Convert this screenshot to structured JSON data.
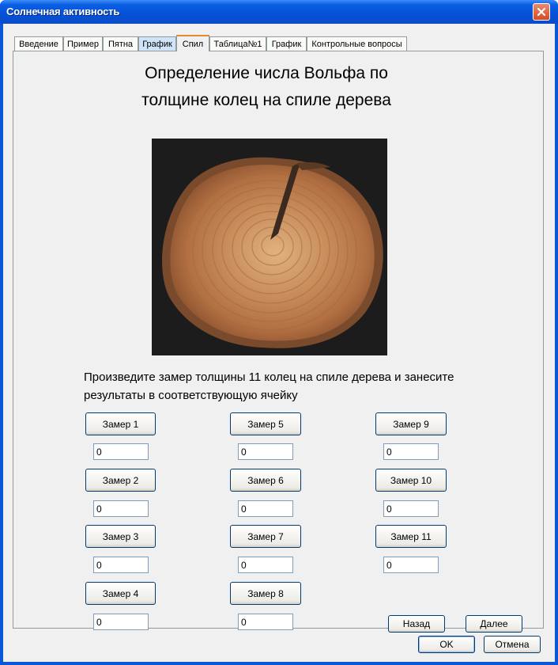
{
  "window": {
    "title": "Солнечная активность"
  },
  "tabs": [
    {
      "label": "Введение"
    },
    {
      "label": "Пример"
    },
    {
      "label": "Пятна"
    },
    {
      "label": "График"
    },
    {
      "label": "Спил"
    },
    {
      "label": "Таблица№1"
    },
    {
      "label": "График"
    },
    {
      "label": "Контрольные вопросы"
    }
  ],
  "active_tab": "Спил",
  "main": {
    "heading_line1": "Определение числа Вольфа по",
    "heading_line2": "толщине колец на спиле дерева",
    "instruction": "Произведите замер толщины 11 колец на спиле дерева и занесите результаты в соответствующую ячейку"
  },
  "measurements": [
    {
      "label": "Замер 1",
      "value": "0"
    },
    {
      "label": "Замер 2",
      "value": "0"
    },
    {
      "label": "Замер 3",
      "value": "0"
    },
    {
      "label": "Замер 4",
      "value": "0"
    },
    {
      "label": "Замер 5",
      "value": "0"
    },
    {
      "label": "Замер 6",
      "value": "0"
    },
    {
      "label": "Замер 7",
      "value": "0"
    },
    {
      "label": "Замер 8",
      "value": "0"
    },
    {
      "label": "Замер 9",
      "value": "0"
    },
    {
      "label": "Замер 10",
      "value": "0"
    },
    {
      "label": "Замер 11",
      "value": "0"
    }
  ],
  "nav": {
    "back_label": "Назад",
    "next_label": "Далее"
  },
  "dialog": {
    "ok_label": "OK",
    "cancel_label": "Отмена"
  }
}
